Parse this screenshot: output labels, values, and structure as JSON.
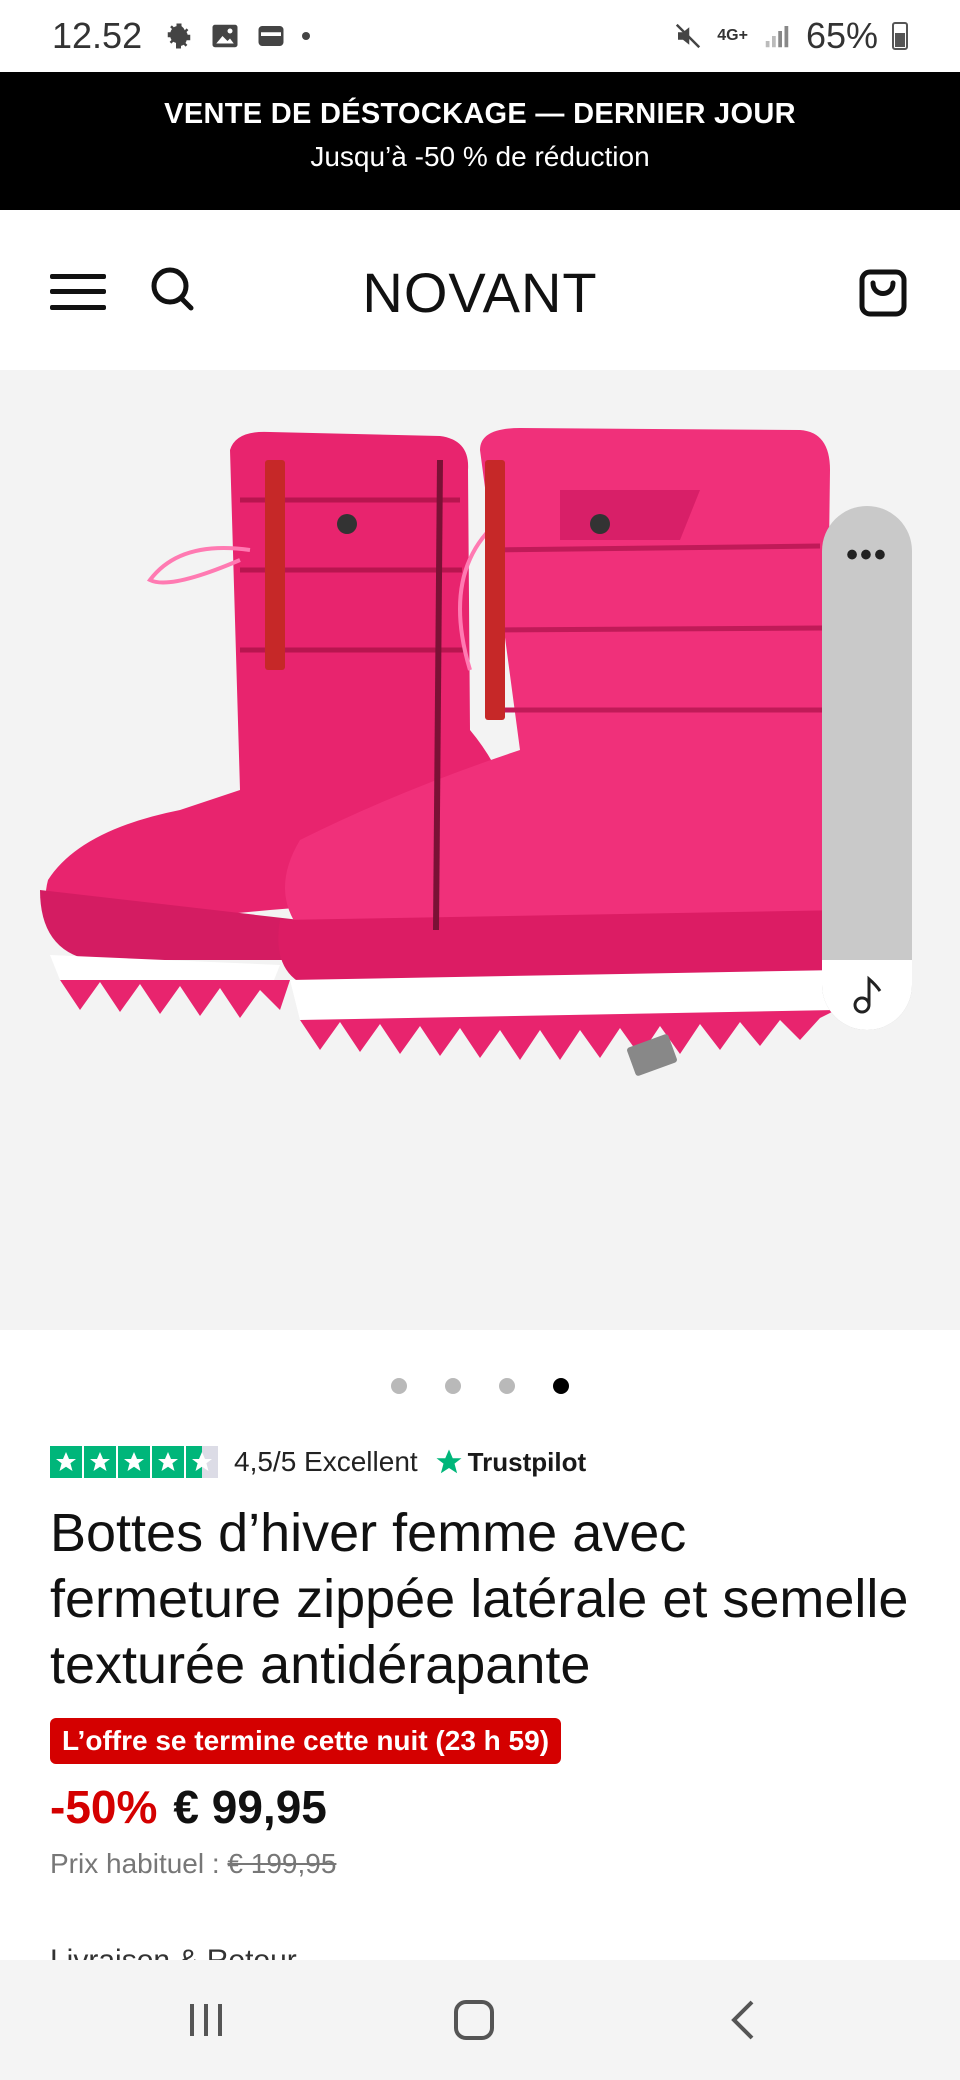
{
  "status_bar": {
    "time": "12.52",
    "network": "4G+",
    "battery": "65%"
  },
  "promo": {
    "title": "VENTE DE DÉSTOCKAGE — DERNIER JOUR",
    "subtitle": "Jusqu’à -50 % de réduction"
  },
  "header": {
    "logo": "NOVANT"
  },
  "gallery": {
    "image_alt": "product-image",
    "slides": 4,
    "active_slide": 4
  },
  "rating": {
    "score": "4,5/5 Excellent",
    "provider": "Trustpilot",
    "stars": 4.5
  },
  "product": {
    "title": "Bottes d’hiver femme avec fermeture zippée latérale et semelle texturée antidérapante",
    "offer_badge": "L’offre se termine cette nuit (23 h 59)",
    "discount": "-50%",
    "price": "€ 99,95",
    "regular_label": "Prix habituel :",
    "regular_price": "€ 199,95",
    "next_section": "Livraison & Retour"
  },
  "colors": {
    "accent_red": "#d40000",
    "trustpilot_green": "#00b67a",
    "boot_pink": "#e8246e"
  }
}
